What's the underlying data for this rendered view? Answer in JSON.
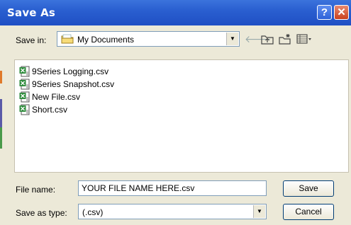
{
  "window": {
    "title": "Save As",
    "help_glyph": "?",
    "close_glyph": "✕"
  },
  "location": {
    "label": "Save in:",
    "value": "My Documents",
    "icon": "folder-icon"
  },
  "toolbar": {
    "icons": [
      "back-arrow-icon",
      "up-folder-icon",
      "new-folder-icon",
      "views-menu-icon"
    ]
  },
  "files": [
    {
      "name": "9Series Logging.csv",
      "icon": "csv-file-icon"
    },
    {
      "name": "9Series Snapshot.csv",
      "icon": "csv-file-icon"
    },
    {
      "name": "New File.csv",
      "icon": "csv-file-icon"
    },
    {
      "name": "Short.csv",
      "icon": "csv-file-icon"
    }
  ],
  "filename": {
    "label": "File name:",
    "value": "YOUR FILE NAME HERE.csv"
  },
  "filetype": {
    "label": "Save as type:",
    "value": "(.csv)"
  },
  "buttons": {
    "save": "Save",
    "cancel": "Cancel"
  },
  "colors": {
    "titlebar": "#2a5fd0",
    "dialog_bg": "#ece9d8",
    "excel_green": "#2e8b3c"
  }
}
